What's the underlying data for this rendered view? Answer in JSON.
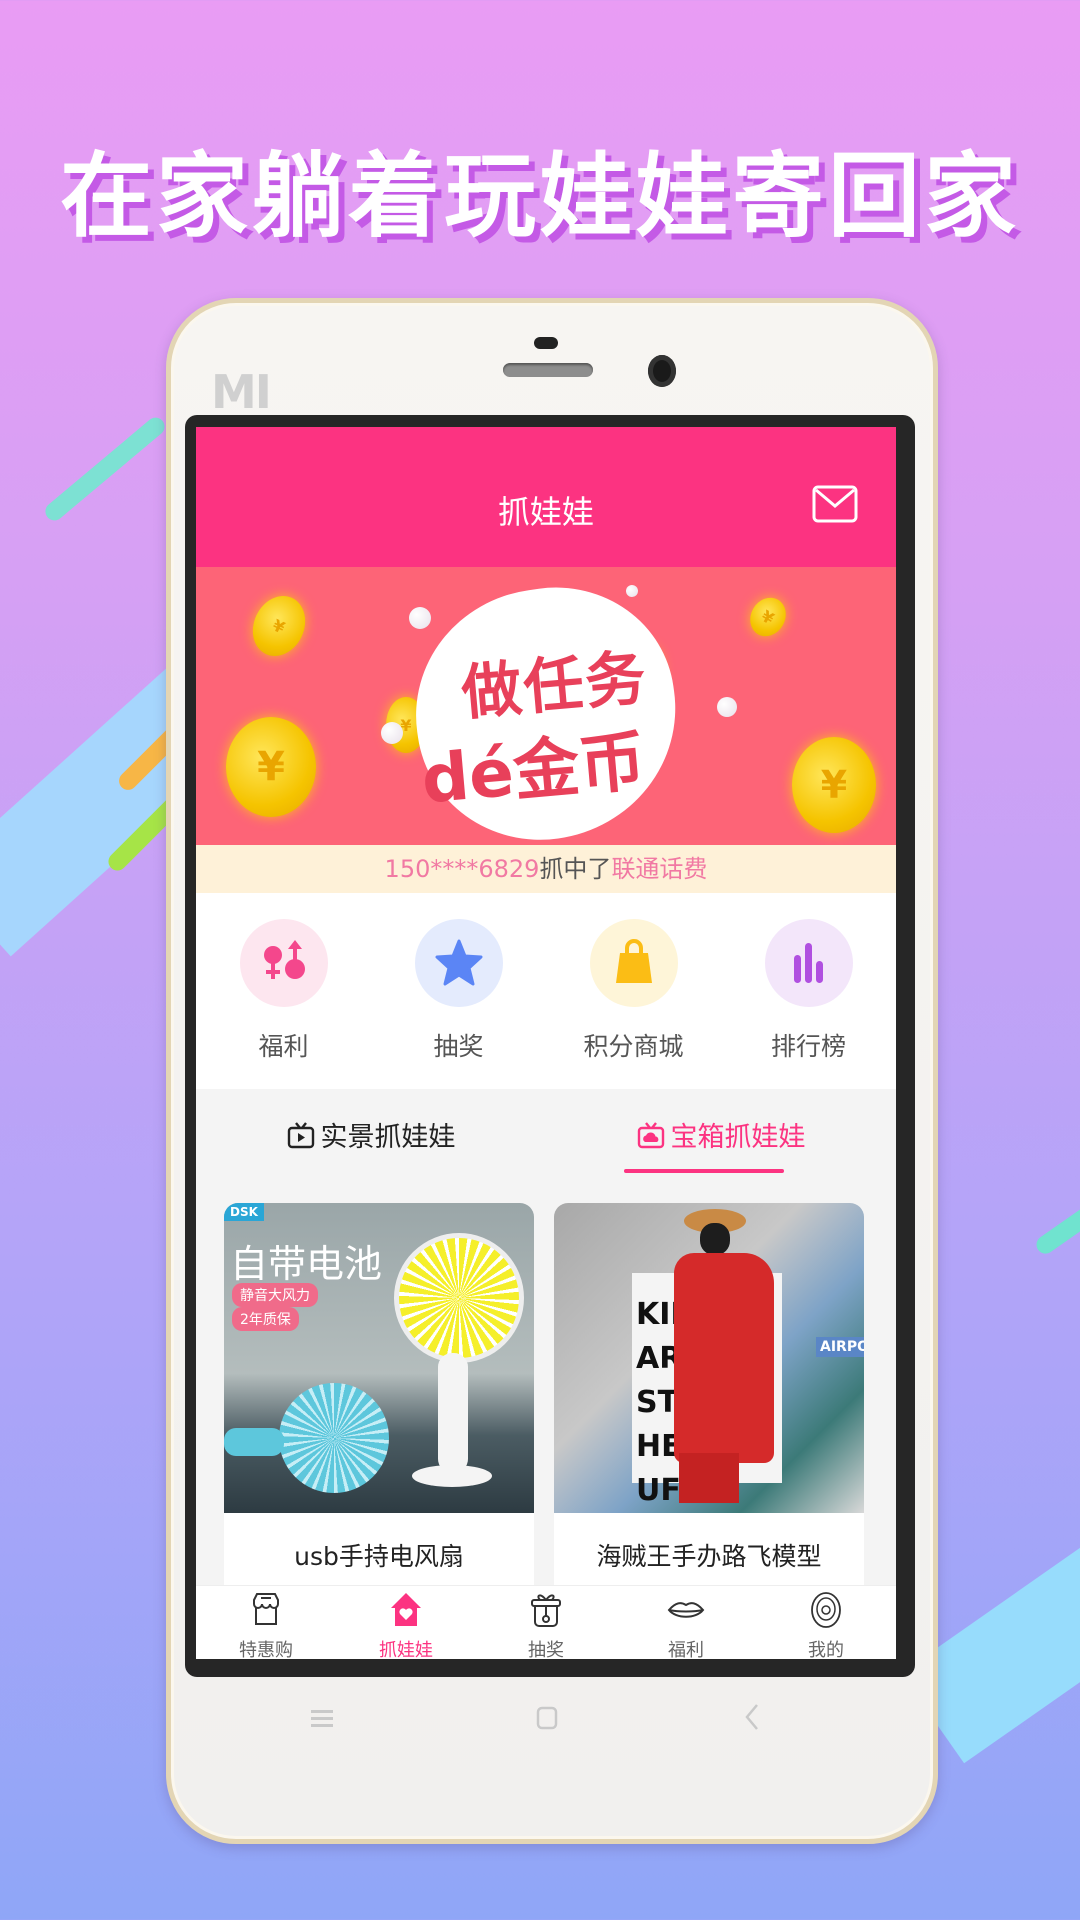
{
  "headline": "在家躺着玩娃娃寄回家",
  "phone": {
    "brand_logo": "MI",
    "nav_keys": [
      "menu-icon",
      "home-icon",
      "back-icon"
    ]
  },
  "app": {
    "title": "抓娃娃",
    "mail_icon": "mail-icon",
    "accent_color": "#fc3381",
    "banner": {
      "line1": "做任务",
      "line2": "dé金币"
    },
    "marquee": {
      "phone": "150****6829",
      "action": "抓中了",
      "prize": "联通话费"
    },
    "shortcuts": [
      {
        "label": "福利",
        "icon": "gender-icon",
        "color": "#f4478c",
        "bg": "#fde6ef"
      },
      {
        "label": "抽奖",
        "icon": "star-icon",
        "color": "#5b85f5",
        "bg": "#e4ebfd"
      },
      {
        "label": "积分商城",
        "icon": "shopping-bag-icon",
        "color": "#fbbd15",
        "bg": "#fef5d8"
      },
      {
        "label": "排行榜",
        "icon": "bar-chart-icon",
        "color": "#b050e0",
        "bg": "#f3e6fa"
      }
    ],
    "tabs": [
      {
        "label": "实景抓娃娃",
        "icon": "tv-play-icon",
        "active": false
      },
      {
        "label": "宝箱抓娃娃",
        "icon": "tv-cloud-icon",
        "active": true
      }
    ],
    "products": [
      {
        "title": "usb手持电风扇",
        "image_text": {
          "brand": "DSK",
          "headline": "自带电池",
          "tag1": "静音大风力",
          "tag2": "2年质保"
        }
      },
      {
        "title": "海贼王手办路飞模型",
        "image_text": {
          "box": "KING ARTIST THE LUFFY",
          "sign": "AIRPO"
        }
      }
    ],
    "tabbar": [
      {
        "label": "特惠购",
        "icon": "shop-icon",
        "active": false
      },
      {
        "label": "抓娃娃",
        "icon": "house-heart-icon",
        "active": true
      },
      {
        "label": "抽奖",
        "icon": "gift-box-icon",
        "active": false
      },
      {
        "label": "福利",
        "icon": "lips-icon",
        "active": false
      },
      {
        "label": "我的",
        "icon": "profile-icon",
        "active": false
      }
    ]
  }
}
